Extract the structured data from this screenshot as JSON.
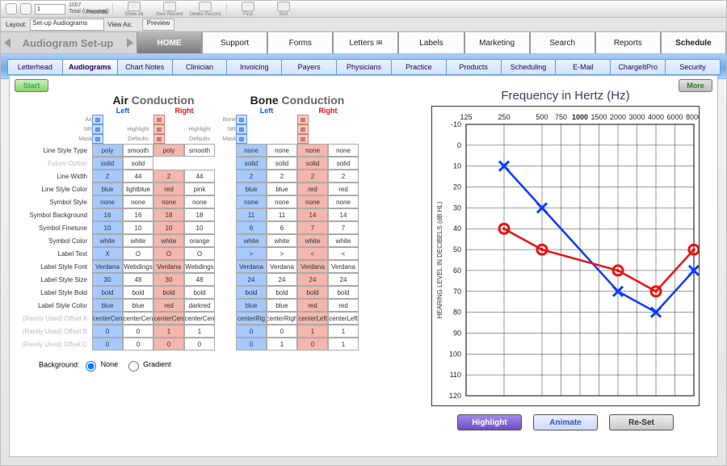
{
  "os": {
    "record": "1",
    "total": "1007",
    "totalLabel": "Total (Unsorted)",
    "recordsLabel": "Records",
    "buttons": [
      "Show All",
      "New Record",
      "Delete Record",
      "Find",
      "Sort"
    ]
  },
  "layoutbar": {
    "layoutLabel": "Layout:",
    "layout": "Set-up Audiograms",
    "viewAsLabel": "View As:",
    "preview": "Preview"
  },
  "title": "Audiogram Set-up",
  "maintabs": [
    "HOME",
    "Support",
    "Forms",
    "Letters",
    "Labels",
    "Marketing",
    "Search",
    "Reports",
    "Schedule"
  ],
  "subtabs": [
    "Letterhead",
    "Audiograms",
    "Chart Notes",
    "Clinician",
    "Invoicing",
    "Payers",
    "Physicians",
    "Practice",
    "Products",
    "Scheduling",
    "E-Mail",
    "ChargeItPro",
    "Security"
  ],
  "startLabel": "Start",
  "moreLabel": "More",
  "sections": {
    "air": "Air",
    "airC": "Conduction",
    "bone": "Bone",
    "boneC": "Conduction"
  },
  "lr": {
    "left": "Left",
    "right": "Right"
  },
  "mini": [
    "Air",
    "NR",
    "Mask",
    "Bone"
  ],
  "hd": {
    "hl": "Highlight",
    "df": "Defaults"
  },
  "rows": [
    {
      "l": "Line Style Type",
      "a": [
        "poly",
        "smooth",
        "poly",
        "smooth"
      ],
      "b": [
        "none",
        "none",
        "none",
        "none"
      ]
    },
    {
      "l": "Future Option",
      "d": 1,
      "a": [
        "solid",
        "solid",
        "",
        ""
      ],
      "b": [
        "solid",
        "solid",
        "solid",
        "solid"
      ],
      "two": 1
    },
    {
      "l": "Line Width",
      "a": [
        "2",
        "44",
        "2",
        "44"
      ],
      "b": [
        "2",
        "2",
        "2",
        "2"
      ]
    },
    {
      "l": "Line Style Color",
      "a": [
        "blue",
        "lightblue",
        "red",
        "pink"
      ],
      "b": [
        "blue",
        "blue",
        "red",
        "red"
      ]
    },
    {
      "l": "Symbol Style",
      "a": [
        "none",
        "none",
        "none",
        "none"
      ],
      "b": [
        "none",
        "none",
        "none",
        "none"
      ]
    },
    {
      "l": "Symbol Background",
      "a": [
        "16",
        "16",
        "18",
        "18"
      ],
      "b": [
        "11",
        "11",
        "14",
        "14"
      ]
    },
    {
      "l": "Symbol Finetune",
      "a": [
        "10",
        "10",
        "10",
        "10"
      ],
      "b": [
        "6",
        "6",
        "7",
        "7"
      ]
    },
    {
      "l": "Symbol Color",
      "a": [
        "white",
        "white",
        "white",
        "orange"
      ],
      "b": [
        "white",
        "white",
        "white",
        "white"
      ]
    },
    {
      "l": "Label Text",
      "a": [
        "X",
        "O",
        "O",
        "O"
      ],
      "b": [
        ">",
        ">",
        "<",
        "<"
      ]
    },
    {
      "l": "Label Style Font",
      "a": [
        "Verdana",
        "Webdings",
        "Verdana",
        "Webdings"
      ],
      "b": [
        "Verdana",
        "Verdana",
        "Verdana",
        "Verdana"
      ]
    },
    {
      "l": "Label Style Size",
      "a": [
        "30",
        "48",
        "30",
        "48"
      ],
      "b": [
        "24",
        "24",
        "24",
        "24"
      ]
    },
    {
      "l": "Label Style Bold",
      "a": [
        "bold",
        "bold",
        "bold",
        "bold"
      ],
      "b": [
        "bold",
        "bold",
        "bold",
        "bold"
      ]
    },
    {
      "l": "Label Style Color",
      "a": [
        "blue",
        "blue",
        "red",
        "darkred"
      ],
      "b": [
        "blue",
        "blue",
        "red",
        "red"
      ]
    },
    {
      "l": "(Rarely Used) Offset A",
      "d": 1,
      "a": [
        "centerCen",
        "centerCen",
        "centerCen",
        "centerCen"
      ],
      "b": [
        "centerRig",
        "centerRigh",
        "centerLeft",
        "centerLeft"
      ]
    },
    {
      "l": "(Rarely Used) Offset B",
      "d": 1,
      "a": [
        "0",
        "0",
        "1",
        "1"
      ],
      "b": [
        "0",
        "0",
        "1",
        "1"
      ]
    },
    {
      "l": "(Rarely Used) Offset C",
      "d": 1,
      "a": [
        "0",
        "0",
        "0",
        "0"
      ],
      "b": [
        "0",
        "1",
        "0",
        "1"
      ]
    }
  ],
  "bg": {
    "label": "Background:",
    "none": "None",
    "grad": "Gradient"
  },
  "chartTitle": "Frequency in Hertz (Hz)",
  "chartBtns": {
    "hl": "Highlight",
    "an": "Animate",
    "rs": "Re-Set"
  },
  "chart_data": {
    "type": "line",
    "title": "Frequency in Hertz (Hz)",
    "xlabel": "Frequency in Hertz (Hz)",
    "ylabel": "HEARING LEVEL IN DECIBELS (dB HL)",
    "xticks": [
      125,
      250,
      500,
      750,
      1000,
      1500,
      2000,
      3000,
      4000,
      6000,
      8000
    ],
    "xticks_bold": [
      1000
    ],
    "ylim": [
      -10,
      120
    ],
    "yticks": [
      -10,
      0,
      10,
      20,
      30,
      40,
      50,
      60,
      70,
      80,
      90,
      100,
      110,
      120
    ],
    "series": [
      {
        "name": "Left (X blue)",
        "marker": "X",
        "color": "#0b3bff",
        "points": [
          {
            "x": 250,
            "y": 10
          },
          {
            "x": 500,
            "y": 30
          },
          {
            "x": 2000,
            "y": 70
          },
          {
            "x": 4000,
            "y": 80
          },
          {
            "x": 8000,
            "y": 60
          }
        ]
      },
      {
        "name": "Right (O red)",
        "marker": "O",
        "color": "#e11",
        "points": [
          {
            "x": 250,
            "y": 40
          },
          {
            "x": 500,
            "y": 50
          },
          {
            "x": 2000,
            "y": 60
          },
          {
            "x": 4000,
            "y": 70
          },
          {
            "x": 8000,
            "y": 50
          }
        ]
      }
    ]
  }
}
